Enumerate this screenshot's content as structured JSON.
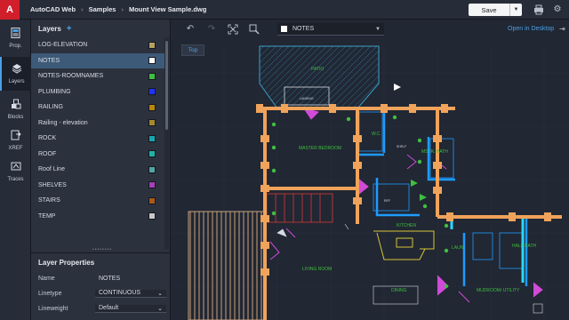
{
  "app": {
    "logo_letter": "A",
    "breadcrumb": [
      "AutoCAD Web",
      "Samples",
      "Mount View Sample.dwg"
    ],
    "save_label": "Save",
    "save_dropdown_icon": "chevron-down-icon",
    "print_icon": "printer-icon",
    "settings_icon": "gear-icon"
  },
  "rail": [
    {
      "label": "Prop.",
      "icon": "properties-icon"
    },
    {
      "label": "Layers",
      "icon": "layers-icon"
    },
    {
      "label": "Blocks",
      "icon": "blocks-icon"
    },
    {
      "label": "XREF",
      "icon": "xref-icon"
    },
    {
      "label": "Traces",
      "icon": "traces-icon"
    }
  ],
  "layers_panel": {
    "title": "Layers",
    "add_icon": "plus-icon",
    "items": [
      {
        "name": "LOG-ELEVATION",
        "color": "#b3a160"
      },
      {
        "name": "NOTES",
        "color": "#ffffff",
        "selected": true
      },
      {
        "name": "NOTES-ROOMNAMES",
        "color": "#3fbf3f"
      },
      {
        "name": "PLUMBING",
        "color": "#1f33ff"
      },
      {
        "name": "RAILING",
        "color": "#b8860b"
      },
      {
        "name": "Railing - elevation",
        "color": "#a5892d"
      },
      {
        "name": "ROCK",
        "color": "#18a5b0"
      },
      {
        "name": "ROOF",
        "color": "#1fb3a8"
      },
      {
        "name": "Roof Line",
        "color": "#55a4a0"
      },
      {
        "name": "SHELVES",
        "color": "#a83fb5"
      },
      {
        "name": "STAIRS",
        "color": "#a85a18"
      },
      {
        "name": "TEMP",
        "color": "#c8c8c8"
      }
    ]
  },
  "layer_properties": {
    "title": "Layer Properties",
    "name_label": "Name",
    "name_value": "NOTES",
    "linetype_label": "Linetype",
    "linetype_value": "CONTINUOUS",
    "lineweight_label": "Lineweight",
    "lineweight_value": "Default"
  },
  "canvas": {
    "current_layer": "NOTES",
    "current_layer_color": "#ffffff",
    "open_in_desktop": "Open in Desktop",
    "view_label": "Top",
    "undo_icon": "undo-icon",
    "redo_icon": "redo-icon",
    "zoom_extents_icon": "zoom-extents-icon",
    "zoom_window_icon": "zoom-window-icon",
    "room_labels": [
      "PATIO",
      "LANDING",
      "W.C.",
      "SHELF",
      "MASTER BEDROOM",
      "MSTR. BATH",
      "REF",
      "KITCHEN",
      "LAUN.",
      "HALF BATH",
      "LIVING ROOM",
      "DINING",
      "MUDROOM/ UTILITY"
    ]
  }
}
